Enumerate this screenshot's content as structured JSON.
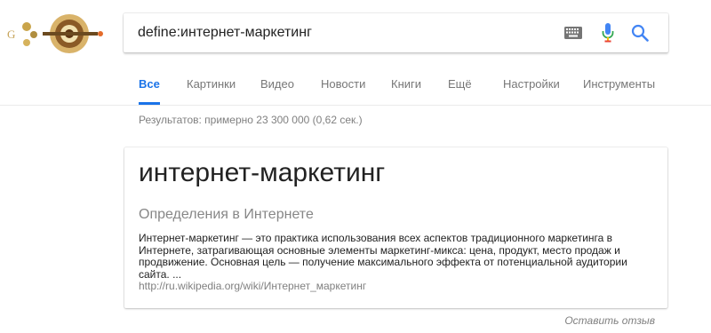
{
  "search": {
    "query": "define:интернет-маркетинг"
  },
  "icons": {
    "keyboard": "keyboard-icon",
    "mic": "microphone-icon",
    "search": "search-icon"
  },
  "colors": {
    "accent": "#1a73e8",
    "mic_blue": "#4285f4",
    "mic_red": "#ea4335"
  },
  "tabs": [
    {
      "label": "Все",
      "active": true
    },
    {
      "label": "Картинки"
    },
    {
      "label": "Видео"
    },
    {
      "label": "Новости"
    },
    {
      "label": "Книги"
    },
    {
      "label": "Ещё"
    },
    {
      "label": "Настройки"
    },
    {
      "label": "Инструменты"
    }
  ],
  "results_stats": "Результатов: примерно 23 300 000 (0,62 сек.)",
  "card": {
    "term": "интернет-маркетинг",
    "subtitle": "Определения в Интернете",
    "definition": "Интернет-маркетинг — это практика использования всех аспектов традиционного маркетинга в Интернете, затрагивающая основные элементы маркетинг-микса: цена, продукт, место продаж и продвижение. Основная цель — получение максимального эффекта от потенциальной аудитории сайта. ...",
    "source_url": "http://ru.wikipedia.org/wiki/Интернет_маркетинг"
  },
  "feedback_label": "Оставить отзыв"
}
